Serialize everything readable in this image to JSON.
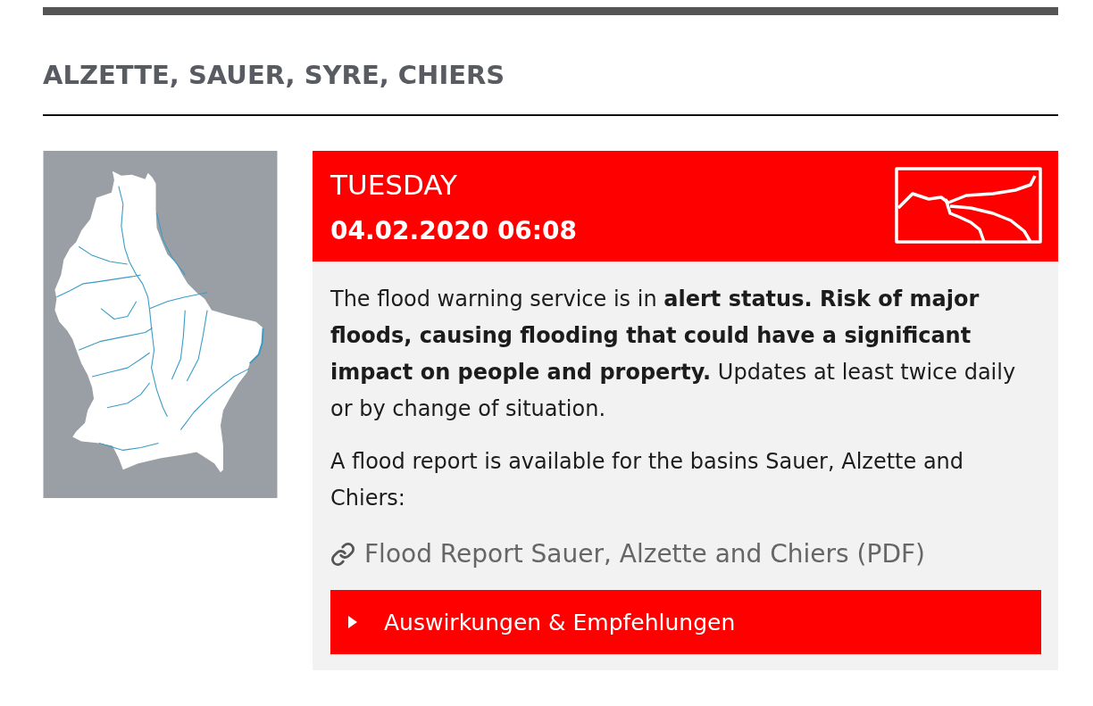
{
  "section": {
    "title": "ALZETTE, SAUER, SYRE, CHIERS"
  },
  "warning": {
    "day": "TUESDAY",
    "datetime": "04.02.2020 06:08",
    "paragraphs": [
      "The flood warning service is in **alert status. Risk of major floods, causing flooding that could have a significant impact on people and property.** Updates at least twice daily or by change of situation.",
      "A flood report is available for the basins Sauer, Alzette and Chiers:"
    ],
    "report_link": "Flood Report Sauer, Alzette and Chiers (PDF)",
    "accordion": {
      "label": "Auswirkungen & Empfehlungen",
      "expanded": false
    }
  }
}
